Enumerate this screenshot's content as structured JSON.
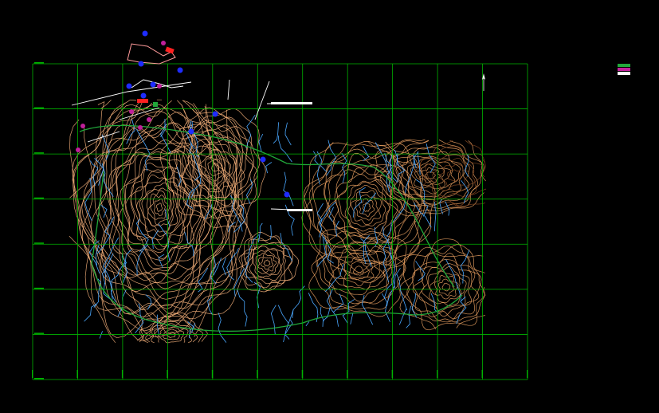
{
  "map": {
    "colors": {
      "background": "#000000",
      "grid": "#00b400",
      "contour_major": "#f5b07a",
      "contour_minor": "#e9a060",
      "contour_dark": "#8a4a22",
      "drainage": "#4aa8ff",
      "road": "#21a83a",
      "annotation": "#ffffff",
      "marker_blue": "#1e2cff",
      "marker_magenta": "#c0209a",
      "marker_red": "#ff2020"
    },
    "grid": {
      "columns": 11,
      "rows": 7
    },
    "legend_swatches": [
      {
        "name": "green-swatch",
        "color": "#21a83a"
      },
      {
        "name": "magenta-swatch",
        "color": "#c0209a"
      },
      {
        "name": "white-swatch",
        "color": "#ffffff"
      }
    ],
    "symbols": [
      "north-arrow-icon",
      "survey-point-icon"
    ]
  }
}
